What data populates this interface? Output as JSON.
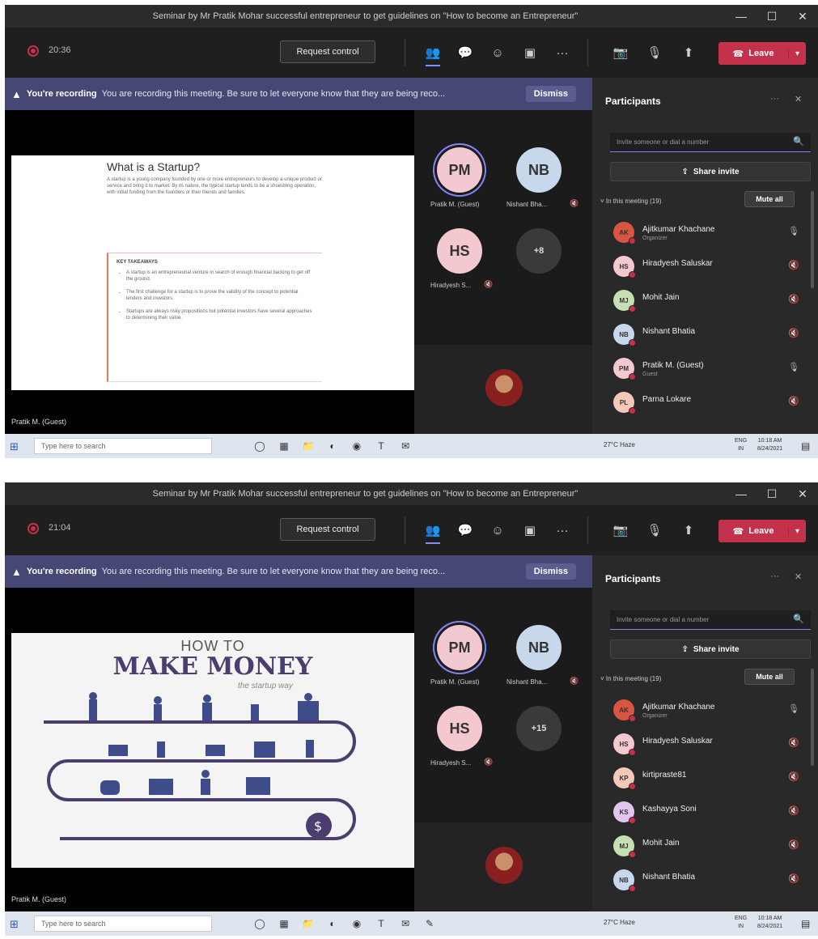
{
  "window_title": "Seminar by Mr Pratik Mohar successful entrepreneur to get guidelines on \"How to become an Entrepreneur\"",
  "window_controls": {
    "minimize": "—",
    "maximize": "☐",
    "close": "✕"
  },
  "toolbar": {
    "request_control": "Request control",
    "more": "···",
    "leave": "Leave"
  },
  "recording_banner": {
    "title": "You're recording",
    "message": "You are recording this meeting. Be sure to let everyone know that they are being reco...",
    "dismiss": "Dismiss"
  },
  "presenter_label": "Pratik M. (Guest)",
  "avatars": {
    "pm": {
      "initials": "PM",
      "label": "Pratik M. (Guest)"
    },
    "nb": {
      "initials": "NB",
      "label": "Nishant Bha..."
    },
    "hs": {
      "initials": "HS",
      "label": "Hiradyesh S..."
    }
  },
  "panel": {
    "title": "Participants",
    "more": "···",
    "close": "✕",
    "invite_placeholder": "Invite someone or dial a number",
    "share_invite": "Share invite",
    "in_meeting": "˅ In this meeting (19)",
    "mute_all": "Mute all"
  },
  "taskbar": {
    "search": "Type here to search",
    "weather": "27°C Haze",
    "lang": "ENG\nIN",
    "time": "10:18 AM\n8/24/2021"
  },
  "shots": [
    {
      "timer": "20:36",
      "more_count": "+8",
      "slide": {
        "kind": "startup",
        "title": "What is a Startup?",
        "intro": "A startup is a young company founded by one or more entrepreneurs to develop a unique product or service and bring it to market. By its nature, the typical startup tends to be a shoestring operation, with initial funding from the founders or their friends and families.",
        "key_title": "KEY TAKEAWAYS",
        "takeaways": [
          "A startup is an entrepreneurial venture in search of enough financial backing to get off the ground.",
          "The first challenge for a startup is to prove the validity of the concept to potential lenders and investors.",
          "Startups are always risky propositions but potential investors have several approaches to determining their value."
        ]
      },
      "participants": [
        {
          "initials": "AK",
          "name": "Ajitkumar Khachane",
          "role": "Organizer",
          "color": "#d8553f",
          "mic": "🎙"
        },
        {
          "initials": "HS",
          "name": "Hiradyesh Saluskar",
          "role": "",
          "color": "#f3c8cf",
          "mic": "🔇"
        },
        {
          "initials": "MJ",
          "name": "Mohit Jain",
          "role": "",
          "color": "#c6e0b4",
          "mic": "🔇"
        },
        {
          "initials": "NB",
          "name": "Nishant Bhatia",
          "role": "",
          "color": "#c7d8ec",
          "mic": "🔇"
        },
        {
          "initials": "PM",
          "name": "Pratik M. (Guest)",
          "role": "Guest",
          "color": "#f2c9d1",
          "mic": "🎙"
        },
        {
          "initials": "PL",
          "name": "Parna Lokare",
          "role": "",
          "color": "#f5c9b8",
          "mic": "🔇"
        }
      ]
    },
    {
      "timer": "21:04",
      "more_count": "+15",
      "slide": {
        "kind": "money",
        "how": "HOW TO",
        "title": "MAKE MONEY",
        "subtitle": "the startup way"
      },
      "participants": [
        {
          "initials": "AK",
          "name": "Ajitkumar Khachane",
          "role": "Organizer",
          "color": "#d8553f",
          "mic": "🎙"
        },
        {
          "initials": "HS",
          "name": "Hiradyesh Saluskar",
          "role": "",
          "color": "#f3c8cf",
          "mic": "🔇"
        },
        {
          "initials": "KP",
          "name": "kirtipraste81",
          "role": "",
          "color": "#f5c9b8",
          "mic": "🔇"
        },
        {
          "initials": "KS",
          "name": "Kashayya Soni",
          "role": "",
          "color": "#e3c6ef",
          "mic": "🔇"
        },
        {
          "initials": "MJ",
          "name": "Mohit Jain",
          "role": "",
          "color": "#c6e0b4",
          "mic": "🔇"
        },
        {
          "initials": "NB",
          "name": "Nishant Bhatia",
          "role": "",
          "color": "#c7d8ec",
          "mic": "🔇"
        }
      ]
    }
  ],
  "colors": {
    "accent": "#7f85f5",
    "leave": "#c4314b",
    "banner": "#464775"
  }
}
